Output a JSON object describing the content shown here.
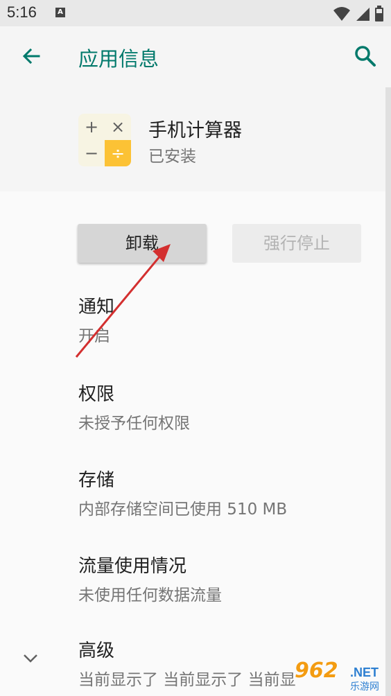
{
  "status_bar": {
    "time": "5:16",
    "notification_icon": "A",
    "icons": [
      "wifi-icon",
      "signal-icon",
      "battery-icon"
    ]
  },
  "app_bar": {
    "title": "应用信息",
    "back_icon": "arrow-left-icon",
    "search_icon": "search-icon",
    "accent_color": "#00796b"
  },
  "app_header": {
    "name": "手机计算器",
    "status": "已安装",
    "icon_glyphs": [
      "+",
      "×",
      "−",
      "÷"
    ],
    "icon_accent": "#fcc235"
  },
  "buttons": {
    "uninstall": "卸载",
    "force_stop": "强行停止"
  },
  "items": [
    {
      "title": "通知",
      "summary": "开启"
    },
    {
      "title": "权限",
      "summary": "未授予任何权限"
    },
    {
      "title": "存储",
      "summary": "内部存储空间已使用 510 MB"
    },
    {
      "title": "流量使用情况",
      "summary": "未使用任何数据流量"
    },
    {
      "title": "高级",
      "summary": "当前显示了 当前显示了 当前显"
    }
  ],
  "watermark": {
    "number": "962",
    "domain": ".NET",
    "site": "乐游网"
  },
  "annotation": {
    "color": "#d32f2f"
  }
}
